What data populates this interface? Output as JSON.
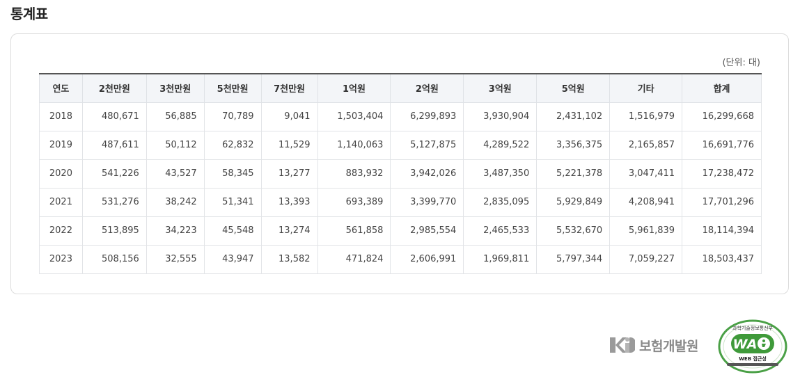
{
  "page_title": "통계표",
  "unit_label": "(단위: 대)",
  "table": {
    "headers": [
      "연도",
      "2천만원",
      "3천만원",
      "5천만원",
      "7천만원",
      "1억원",
      "2억원",
      "3억원",
      "5억원",
      "기타",
      "합계"
    ],
    "rows": [
      [
        "2018",
        "480,671",
        "56,885",
        "70,789",
        "9,041",
        "1,503,404",
        "6,299,893",
        "3,930,904",
        "2,431,102",
        "1,516,979",
        "16,299,668"
      ],
      [
        "2019",
        "487,611",
        "50,112",
        "62,832",
        "11,529",
        "1,140,063",
        "5,127,875",
        "4,289,522",
        "3,356,375",
        "2,165,857",
        "16,691,776"
      ],
      [
        "2020",
        "541,226",
        "43,527",
        "58,345",
        "13,277",
        "883,932",
        "3,942,026",
        "3,487,350",
        "5,221,378",
        "3,047,411",
        "17,238,472"
      ],
      [
        "2021",
        "531,276",
        "38,242",
        "51,341",
        "13,393",
        "693,389",
        "3,399,770",
        "2,835,095",
        "5,929,849",
        "4,208,941",
        "17,701,296"
      ],
      [
        "2022",
        "513,895",
        "34,223",
        "45,548",
        "13,274",
        "561,858",
        "2,985,554",
        "2,465,533",
        "5,532,670",
        "5,961,839",
        "18,114,394"
      ],
      [
        "2023",
        "508,156",
        "32,555",
        "43,947",
        "13,582",
        "471,824",
        "2,606,991",
        "1,969,811",
        "5,797,344",
        "7,059,227",
        "18,503,437"
      ]
    ]
  },
  "footer": {
    "org_logo_icon": "kidi-logo-icon",
    "org_name": "보험개발원",
    "badge_icon": "wa-certification-icon",
    "badge_top_text": "과학기술정보통신부",
    "badge_mark_text": "WA",
    "badge_bottom_text": "WEB 접근성"
  },
  "colors": {
    "header_bg": "#f3f5f8",
    "header_top_border": "#555555",
    "badge_green": "#3f9a3a",
    "logo_gray": "#8a8a8a"
  }
}
